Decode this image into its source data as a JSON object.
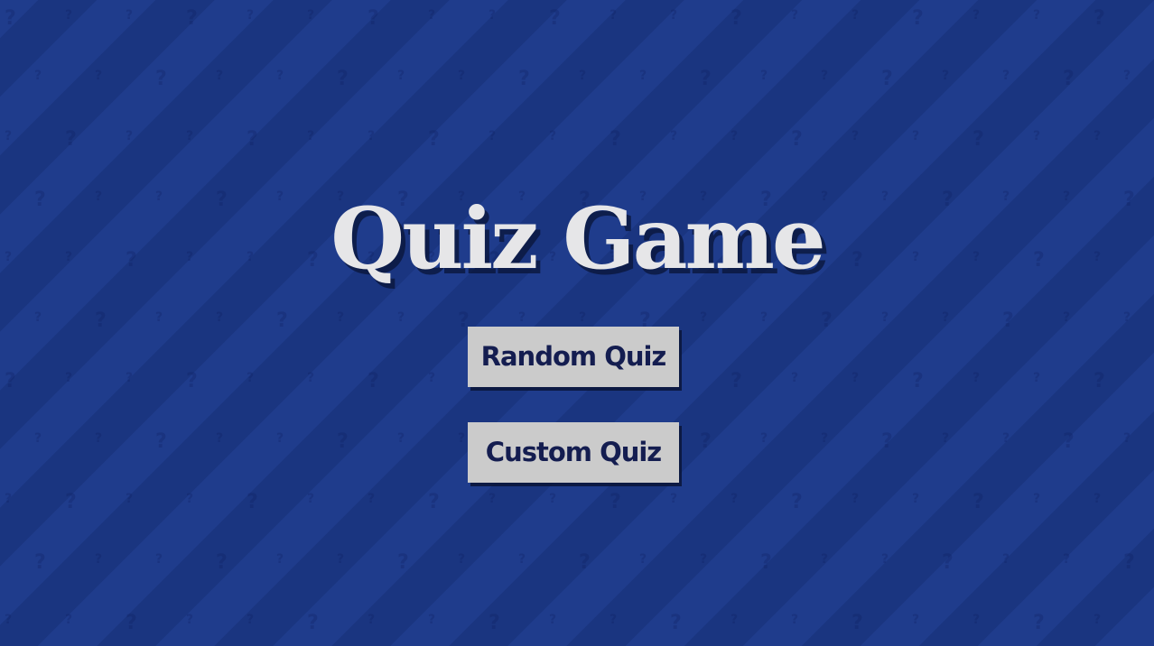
{
  "title": "Quiz Game",
  "buttons": {
    "random_label": "Random Quiz",
    "custom_label": "Custom Quiz"
  },
  "background": {
    "pattern_icon": "question-mark-icon"
  },
  "colors": {
    "background": "#1e3b8a",
    "stripe_dark": "#1a3580",
    "title_text": "#e6e6e8",
    "button_bg": "#cbcbcb",
    "button_text": "#141d50"
  }
}
